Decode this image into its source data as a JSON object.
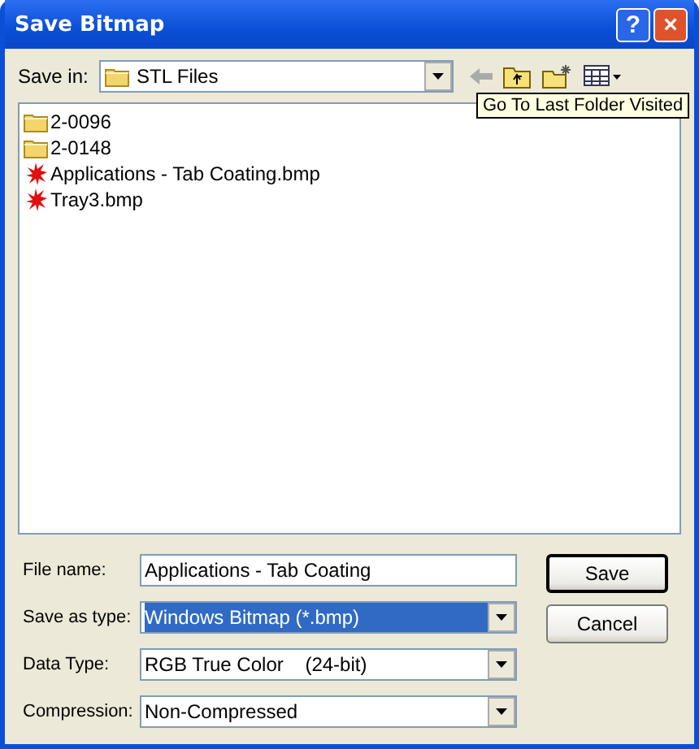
{
  "window": {
    "title": "Save Bitmap",
    "controls": [
      "?",
      "×"
    ]
  },
  "save_in": {
    "label": "Save in:",
    "value": "STL Files"
  },
  "tooltip": "Go To Last Folder Visited",
  "files": [
    {
      "name": "2-0096",
      "kind": "folder"
    },
    {
      "name": "2-0148",
      "kind": "folder"
    },
    {
      "name": "Applications - Tab Coating.bmp",
      "kind": "bitmap"
    },
    {
      "name": "Tray3.bmp",
      "kind": "bitmap"
    }
  ],
  "fields": [
    {
      "label": "File name:",
      "value": "Applications - Tab Coating",
      "kind": "text",
      "highlighted": false
    },
    {
      "label": "Save as type:",
      "value": "Windows Bitmap (*.bmp)",
      "kind": "combo",
      "highlighted": true
    },
    {
      "label": "Data Type:",
      "value": "RGB True Color    (24-bit)",
      "kind": "combo",
      "highlighted": false
    },
    {
      "label": "Compression:",
      "value": "Non-Compressed",
      "kind": "combo",
      "highlighted": false
    }
  ],
  "buttons": [
    {
      "label": "Save",
      "default": true
    },
    {
      "label": "Cancel",
      "default": false
    }
  ]
}
